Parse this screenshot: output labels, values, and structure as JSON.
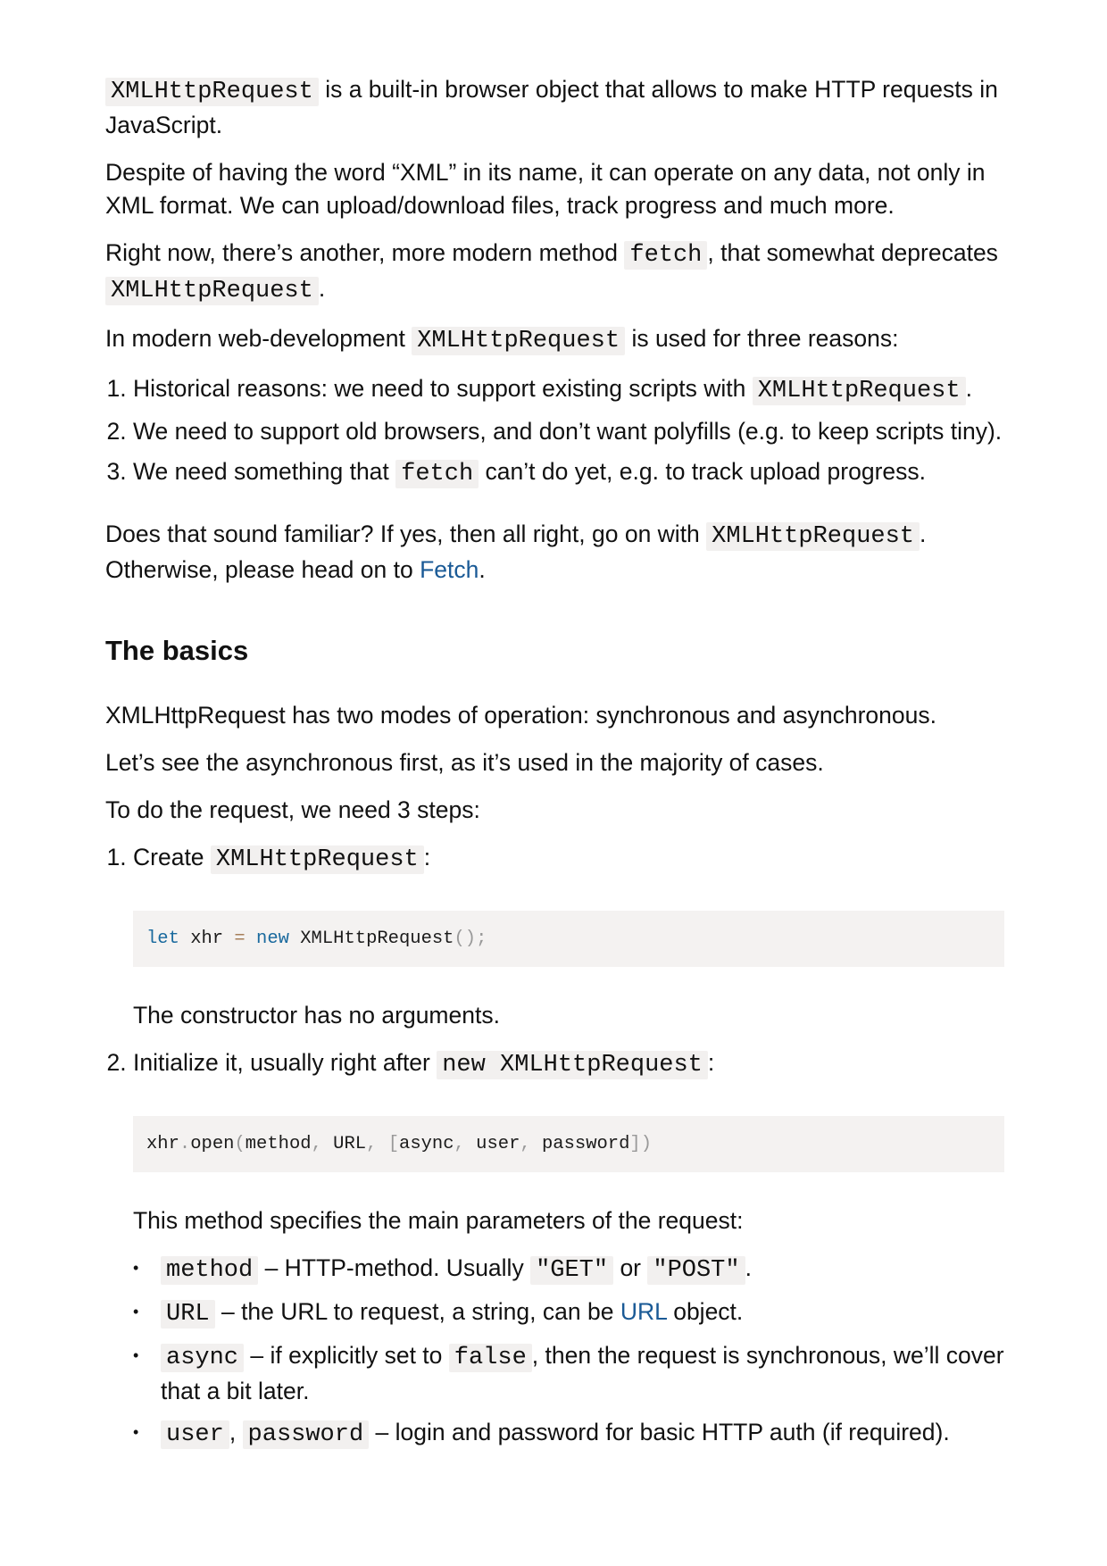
{
  "intro": {
    "p1_code": "XMLHttpRequest",
    "p1_text": " is a built-in browser object that allows to make HTTP requests in JavaScript.",
    "p2": "Despite of having the word “XML” in its name, it can operate on any data, not only in XML format. We can upload/download files, track progress and much more.",
    "p3_a": "Right now, there’s another, more modern method ",
    "p3_code1": "fetch",
    "p3_b": ", that somewhat deprecates ",
    "p3_code2": "XMLHttpRequest",
    "p3_c": ".",
    "p4_a": "In modern web-development ",
    "p4_code": "XMLHttpRequest",
    "p4_b": " is used for three reasons:"
  },
  "reasons": [
    {
      "text_a": "Historical reasons: we need to support existing scripts with ",
      "code": "XMLHttpRequest",
      "text_b": "."
    },
    {
      "text_a": "We need to support old browsers, and don’t want polyfills (e.g. to keep scripts tiny).",
      "code": "",
      "text_b": ""
    },
    {
      "text_a": "We need something that ",
      "code": "fetch",
      "text_b": " can’t do yet, e.g. to track upload progress."
    }
  ],
  "familiar": {
    "a": "Does that sound familiar? If yes, then all right, go on with ",
    "code": "XMLHttpRequest",
    "b": ". Otherwise, please head on to ",
    "link": "Fetch",
    "c": "."
  },
  "basics": {
    "heading": "The basics",
    "p1": "XMLHttpRequest has two modes of operation: synchronous and asynchronous.",
    "p2": "Let’s see the asynchronous first, as it’s used in the majority of cases.",
    "p3": "To do the request, we need 3 steps:"
  },
  "steps": [
    {
      "text_a": "Create ",
      "code": "XMLHttpRequest",
      "text_b": ":",
      "codeblock": {
        "t1": "let",
        "t2": " xhr ",
        "t3": "=",
        "t4": " ",
        "t5": "new",
        "t6": " XMLHttpRequest",
        "t7": "();"
      },
      "after": "The constructor has no arguments."
    },
    {
      "text_a": "Initialize it, usually right after ",
      "code": "new XMLHttpRequest",
      "text_b": ":",
      "codeblock": {
        "t1": "xhr",
        "t2": ".",
        "t3": "open",
        "t4": "(",
        "t5": "method",
        "t6": ",",
        "t7": " URL",
        "t8": ",",
        "t9": " ",
        "t10": "[",
        "t11": "async",
        "t12": ",",
        "t13": " user",
        "t14": ",",
        "t15": " password",
        "t16": "])"
      },
      "after": "This method specifies the main parameters of the request:"
    }
  ],
  "params": [
    {
      "code1": "method",
      "a": " – HTTP-method. Usually ",
      "code2": "\"GET\"",
      "b": " or ",
      "code3": "\"POST\"",
      "c": "."
    },
    {
      "code1": "URL",
      "a": " – the URL to request, a string, can be ",
      "link": "URL",
      "b": " object."
    },
    {
      "code1": "async",
      "a": " – if explicitly set to ",
      "code2": "false",
      "b": ", then the request is synchronous, we’ll cover that a bit later."
    },
    {
      "code1": "user",
      "a": ", ",
      "code2": "password",
      "b": " – login and password for basic HTTP auth (if required)."
    }
  ],
  "colors": {
    "link": "#1a5a96",
    "keyword": "#1a6a9e",
    "operator": "#a67f59",
    "punctuation": "#999999",
    "code_bg": "#f2f0ef"
  }
}
